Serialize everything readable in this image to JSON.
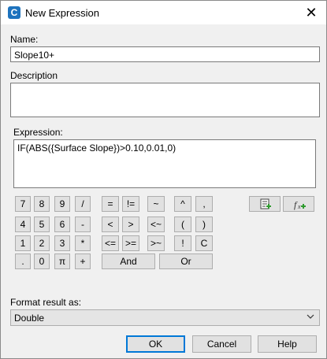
{
  "window": {
    "title": "New Expression",
    "close_glyph": "✕",
    "app_icon_letter": "C"
  },
  "name": {
    "label": "Name:",
    "value": "Slope10+"
  },
  "description": {
    "label": "Description",
    "value": ""
  },
  "expression": {
    "label": "Expression:",
    "value": "IF(ABS({Surface Slope})>0.10,0.01,0)"
  },
  "keypad": {
    "r1": [
      "7",
      "8",
      "9",
      "/"
    ],
    "r2": [
      "4",
      "5",
      "6",
      "-"
    ],
    "r3": [
      "1",
      "2",
      "3",
      "*"
    ],
    "r4": [
      ".",
      "0",
      "π",
      "+"
    ],
    "ops1": [
      "=",
      "!=",
      "~",
      "^",
      ","
    ],
    "ops2": [
      "<",
      ">",
      "<~",
      "(",
      ")"
    ],
    "ops3": [
      "<=",
      ">=",
      ">~",
      "!",
      "C"
    ],
    "and": "And",
    "or": "Or"
  },
  "format": {
    "label": "Format result as:",
    "value": "Double"
  },
  "buttons": {
    "ok": "OK",
    "cancel": "Cancel",
    "help": "Help"
  }
}
